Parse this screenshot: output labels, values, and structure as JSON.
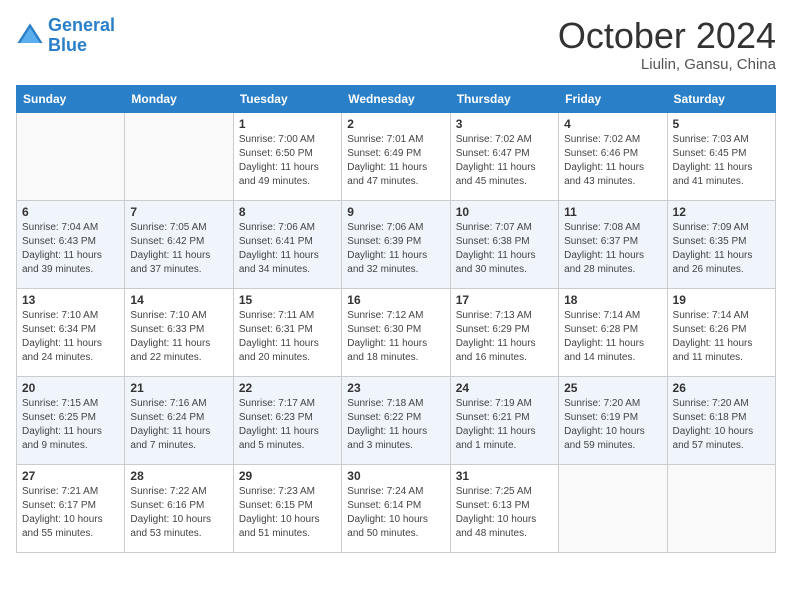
{
  "logo": {
    "line1": "General",
    "line2": "Blue"
  },
  "title": "October 2024",
  "subtitle": "Liulin, Gansu, China",
  "days_of_week": [
    "Sunday",
    "Monday",
    "Tuesday",
    "Wednesday",
    "Thursday",
    "Friday",
    "Saturday"
  ],
  "weeks": [
    [
      {
        "day": "",
        "info": ""
      },
      {
        "day": "",
        "info": ""
      },
      {
        "day": "1",
        "info": "Sunrise: 7:00 AM\nSunset: 6:50 PM\nDaylight: 11 hours and 49 minutes."
      },
      {
        "day": "2",
        "info": "Sunrise: 7:01 AM\nSunset: 6:49 PM\nDaylight: 11 hours and 47 minutes."
      },
      {
        "day": "3",
        "info": "Sunrise: 7:02 AM\nSunset: 6:47 PM\nDaylight: 11 hours and 45 minutes."
      },
      {
        "day": "4",
        "info": "Sunrise: 7:02 AM\nSunset: 6:46 PM\nDaylight: 11 hours and 43 minutes."
      },
      {
        "day": "5",
        "info": "Sunrise: 7:03 AM\nSunset: 6:45 PM\nDaylight: 11 hours and 41 minutes."
      }
    ],
    [
      {
        "day": "6",
        "info": "Sunrise: 7:04 AM\nSunset: 6:43 PM\nDaylight: 11 hours and 39 minutes."
      },
      {
        "day": "7",
        "info": "Sunrise: 7:05 AM\nSunset: 6:42 PM\nDaylight: 11 hours and 37 minutes."
      },
      {
        "day": "8",
        "info": "Sunrise: 7:06 AM\nSunset: 6:41 PM\nDaylight: 11 hours and 34 minutes."
      },
      {
        "day": "9",
        "info": "Sunrise: 7:06 AM\nSunset: 6:39 PM\nDaylight: 11 hours and 32 minutes."
      },
      {
        "day": "10",
        "info": "Sunrise: 7:07 AM\nSunset: 6:38 PM\nDaylight: 11 hours and 30 minutes."
      },
      {
        "day": "11",
        "info": "Sunrise: 7:08 AM\nSunset: 6:37 PM\nDaylight: 11 hours and 28 minutes."
      },
      {
        "day": "12",
        "info": "Sunrise: 7:09 AM\nSunset: 6:35 PM\nDaylight: 11 hours and 26 minutes."
      }
    ],
    [
      {
        "day": "13",
        "info": "Sunrise: 7:10 AM\nSunset: 6:34 PM\nDaylight: 11 hours and 24 minutes."
      },
      {
        "day": "14",
        "info": "Sunrise: 7:10 AM\nSunset: 6:33 PM\nDaylight: 11 hours and 22 minutes."
      },
      {
        "day": "15",
        "info": "Sunrise: 7:11 AM\nSunset: 6:31 PM\nDaylight: 11 hours and 20 minutes."
      },
      {
        "day": "16",
        "info": "Sunrise: 7:12 AM\nSunset: 6:30 PM\nDaylight: 11 hours and 18 minutes."
      },
      {
        "day": "17",
        "info": "Sunrise: 7:13 AM\nSunset: 6:29 PM\nDaylight: 11 hours and 16 minutes."
      },
      {
        "day": "18",
        "info": "Sunrise: 7:14 AM\nSunset: 6:28 PM\nDaylight: 11 hours and 14 minutes."
      },
      {
        "day": "19",
        "info": "Sunrise: 7:14 AM\nSunset: 6:26 PM\nDaylight: 11 hours and 11 minutes."
      }
    ],
    [
      {
        "day": "20",
        "info": "Sunrise: 7:15 AM\nSunset: 6:25 PM\nDaylight: 11 hours and 9 minutes."
      },
      {
        "day": "21",
        "info": "Sunrise: 7:16 AM\nSunset: 6:24 PM\nDaylight: 11 hours and 7 minutes."
      },
      {
        "day": "22",
        "info": "Sunrise: 7:17 AM\nSunset: 6:23 PM\nDaylight: 11 hours and 5 minutes."
      },
      {
        "day": "23",
        "info": "Sunrise: 7:18 AM\nSunset: 6:22 PM\nDaylight: 11 hours and 3 minutes."
      },
      {
        "day": "24",
        "info": "Sunrise: 7:19 AM\nSunset: 6:21 PM\nDaylight: 11 hours and 1 minute."
      },
      {
        "day": "25",
        "info": "Sunrise: 7:20 AM\nSunset: 6:19 PM\nDaylight: 10 hours and 59 minutes."
      },
      {
        "day": "26",
        "info": "Sunrise: 7:20 AM\nSunset: 6:18 PM\nDaylight: 10 hours and 57 minutes."
      }
    ],
    [
      {
        "day": "27",
        "info": "Sunrise: 7:21 AM\nSunset: 6:17 PM\nDaylight: 10 hours and 55 minutes."
      },
      {
        "day": "28",
        "info": "Sunrise: 7:22 AM\nSunset: 6:16 PM\nDaylight: 10 hours and 53 minutes."
      },
      {
        "day": "29",
        "info": "Sunrise: 7:23 AM\nSunset: 6:15 PM\nDaylight: 10 hours and 51 minutes."
      },
      {
        "day": "30",
        "info": "Sunrise: 7:24 AM\nSunset: 6:14 PM\nDaylight: 10 hours and 50 minutes."
      },
      {
        "day": "31",
        "info": "Sunrise: 7:25 AM\nSunset: 6:13 PM\nDaylight: 10 hours and 48 minutes."
      },
      {
        "day": "",
        "info": ""
      },
      {
        "day": "",
        "info": ""
      }
    ]
  ]
}
